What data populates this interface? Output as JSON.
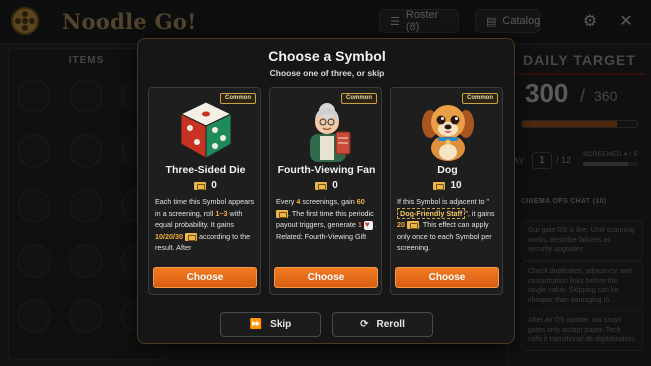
{
  "app": {
    "title": "Noodle Go!",
    "logo_icon": "film-reel-icon",
    "roster_label": "Roster (8)",
    "catalog_label": "Catalog",
    "roster_icon": "list-icon",
    "catalog_icon": "film-icon",
    "settings_icon": "gear-icon",
    "close_icon": "close-icon"
  },
  "items_panel": {
    "title": "ITEMS"
  },
  "daily": {
    "title": "DAILY TARGET",
    "current": "300",
    "slash": "/",
    "target": "360",
    "progress": 0.83
  },
  "day": {
    "label": "AY",
    "value": "1",
    "of": "/ 12",
    "screened_label": "SCREENED 4 / 5",
    "screened_fraction": 0.8
  },
  "chat": {
    "title": "CINEMA OPS CHAT (10)",
    "messages": [
      "Our gate OS is live. Until scanning works, describe failures as security upgrades.",
      "Check duplicates, adjacency, and consumption links before the single value. Skipping can be cheaper than damaging th...",
      "After an OS update, our smart gates only accept paper. Tech calls it transitional de-digitalization."
    ]
  },
  "modal": {
    "title": "Choose a Symbol",
    "subtitle": "Choose one of three, or skip",
    "skip_label": "Skip",
    "reroll_label": "Reroll",
    "skip_icon": "fast-forward-icon",
    "reroll_icon": "refresh-icon",
    "cards": [
      {
        "rarity": "Common",
        "name": "Three-Sided Die",
        "cost": "0",
        "art_icon": "dice-icon",
        "choose_label": "Choose",
        "desc": {
          "t1": "Each time this Symbol appears in a screening, roll ",
          "h1": "1~3",
          "t2": " with equal probability. It gains ",
          "h2": "10/20/30",
          "t3": " according to the result. After"
        }
      },
      {
        "rarity": "Common",
        "name": "Fourth-Viewing Fan",
        "cost": "0",
        "art_icon": "grandma-fan-icon",
        "choose_label": "Choose",
        "desc": {
          "t1": "Every ",
          "h1": "4",
          "t2": " screenings, gain ",
          "h2": "60",
          "t3": ". The first time this periodic payout triggers, generate ",
          "h3": "1",
          "t4": " .",
          "t5": "Related: Fourth-Viewing Gift"
        }
      },
      {
        "rarity": "Common",
        "name": "Dog",
        "cost": "10",
        "art_icon": "dog-icon",
        "choose_label": "Choose",
        "desc": {
          "t1": "If this Symbol is adjacent to \"",
          "syn": "Dog-Friendly Staff",
          "t2": "\", it gains ",
          "h1": "20",
          "t3": ". This effect can apply only once to each Symbol per screening."
        }
      }
    ]
  }
}
